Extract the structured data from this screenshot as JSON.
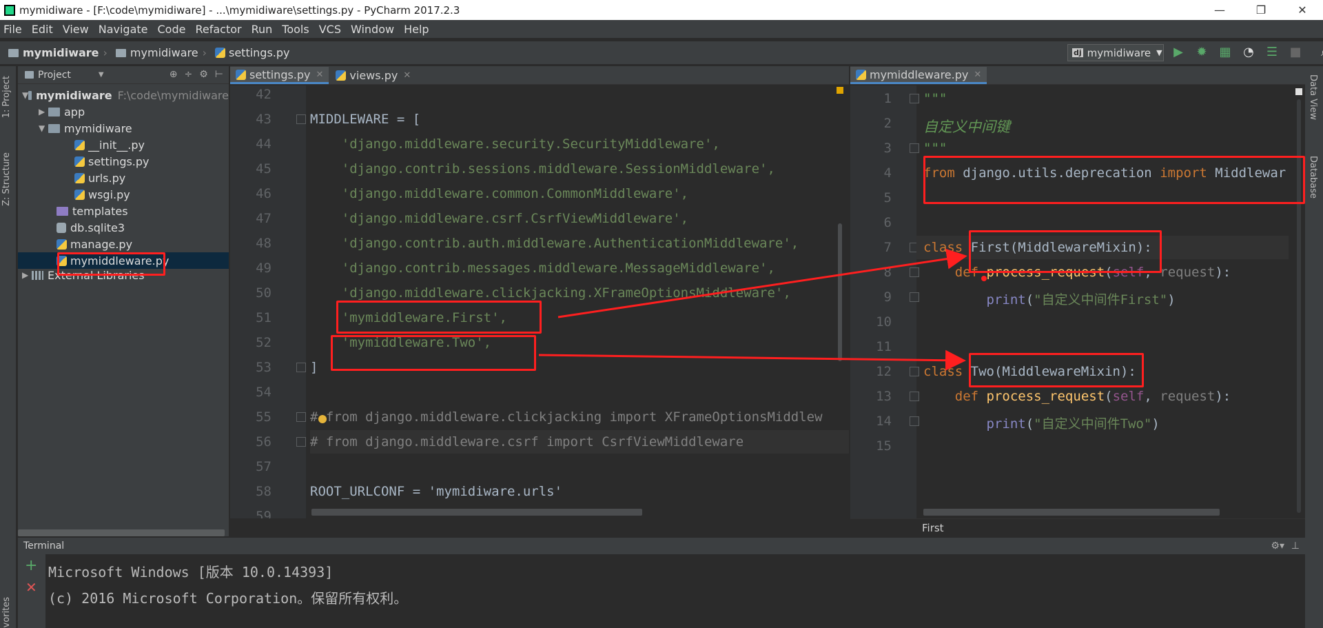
{
  "window": {
    "title": "mymidiware - [F:\\code\\mymidiware] - ...\\mymidiware\\settings.py - PyCharm 2017.2.3",
    "controls": [
      "—",
      "❐",
      "✕"
    ]
  },
  "menu": [
    "File",
    "Edit",
    "View",
    "Navigate",
    "Code",
    "Refactor",
    "Run",
    "Tools",
    "VCS",
    "Window",
    "Help"
  ],
  "navbar": {
    "crumbs": [
      "mymidiware",
      "mymidiware",
      "settings.py"
    ],
    "run_config": "mymidiware",
    "run_config_badge": "dj"
  },
  "left_strip": {
    "project_tab": "1: Project",
    "structure_tab": "Z: Structure",
    "favorites_tab": "vorites"
  },
  "right_strip": {
    "data_view": "Data View",
    "database": "Database"
  },
  "project": {
    "header": "Project",
    "root": {
      "name": "mymidiware",
      "path": "F:\\code\\mymidiware"
    },
    "items": [
      "app",
      "mymidiware",
      "__init__.py",
      "settings.py",
      "urls.py",
      "wsgi.py",
      "templates",
      "db.sqlite3",
      "manage.py",
      "mymiddleware.py",
      "External Libraries"
    ]
  },
  "left_tabs": [
    "settings.py",
    "views.py"
  ],
  "right_tabs": [
    "mymiddleware.py"
  ],
  "left_editor": {
    "line_numbers": [
      "42",
      "43",
      "44",
      "45",
      "46",
      "47",
      "48",
      "49",
      "50",
      "51",
      "52",
      "53",
      "54",
      "55",
      "56",
      "57",
      "58",
      "59"
    ],
    "lines": [
      "",
      "MIDDLEWARE = [",
      "    'django.middleware.security.SecurityMiddleware',",
      "    'django.contrib.sessions.middleware.SessionMiddleware',",
      "    'django.middleware.common.CommonMiddleware',",
      "    'django.middleware.csrf.CsrfViewMiddleware',",
      "    'django.contrib.auth.middleware.AuthenticationMiddleware',",
      "    'django.contrib.messages.middleware.MessageMiddleware',",
      "    'django.middleware.clickjacking.XFrameOptionsMiddleware',",
      "    'mymiddleware.First',",
      "    'mymiddleware.Two',",
      "]",
      "",
      "# from django.middleware.clickjacking import XFrameOptionsMiddlew",
      "# from django.middleware.csrf import CsrfViewMiddleware",
      "",
      "ROOT_URLCONF = 'mymidiware.urls'",
      ""
    ]
  },
  "right_editor": {
    "line_numbers": [
      "1",
      "2",
      "3",
      "4",
      "5",
      "6",
      "7",
      "8",
      "9",
      "10",
      "11",
      "12",
      "13",
      "14",
      "15"
    ],
    "doc_open": "\"\"\"",
    "doc_text": "自定义中间键",
    "doc_close": "\"\"\"",
    "import_from": "from",
    "import_module": " django.utils.deprecation ",
    "import_kw": "import",
    "import_name": " Middlewar",
    "class_kw": "class",
    "class1_name": " First",
    "class1_base": "(MiddlewareMixin):",
    "def_kw": "def",
    "method_name": "process_request",
    "self_kw": "self",
    "request_arg": "request",
    "params_tail": "):",
    "print_kw": "print",
    "print1_str": "\"自定义中间件First\"",
    "class2_name": " Two",
    "class2_base": "(MiddlewareMixin):",
    "print2_str": "\"自定义中间件Two\""
  },
  "editor_breadcrumb": "First",
  "terminal": {
    "header": "Terminal",
    "lines": [
      "Microsoft Windows [版本 10.0.14393]",
      "(c) 2016 Microsoft Corporation。保留所有权利。"
    ]
  },
  "colors": {
    "annotation_red": "#ff1f1f",
    "keyword": "#cc7832",
    "string": "#6a8759",
    "comment": "#808080",
    "docstring": "#629755",
    "function": "#ffc66d"
  }
}
